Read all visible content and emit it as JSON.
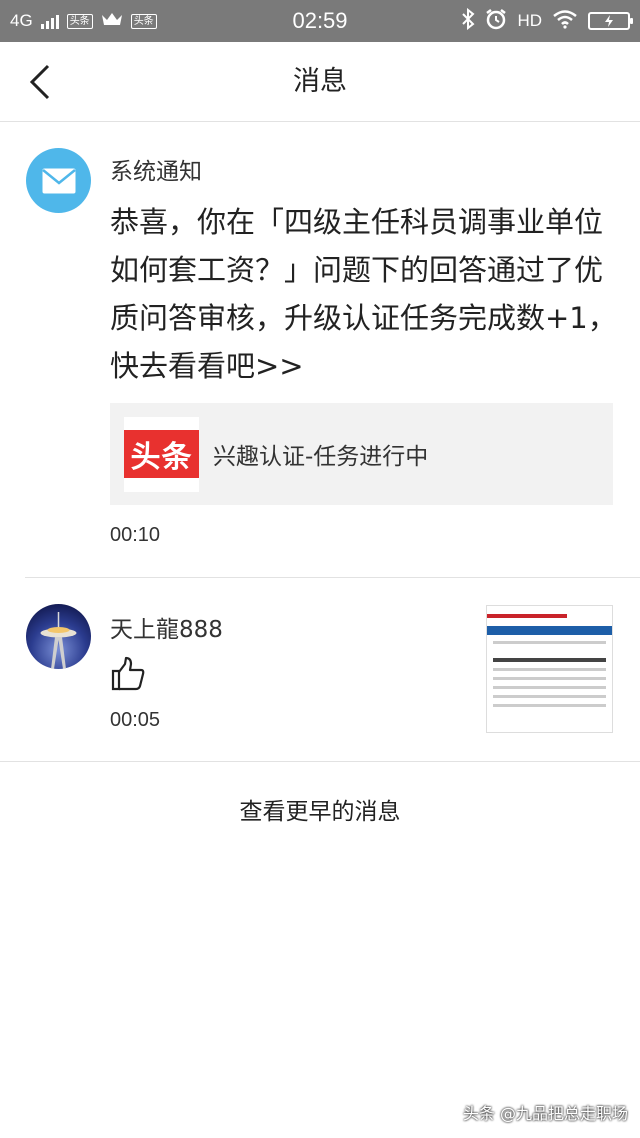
{
  "status_bar": {
    "network": "4G",
    "badge1": "头条",
    "badge2": "头条",
    "time": "02:59",
    "hd": "HD"
  },
  "header": {
    "title": "消息"
  },
  "messages": [
    {
      "sender": "系统通知",
      "body": "恭喜，你在「四级主任科员调事业单位如何套工资？」问题下的回答通过了优质问答审核，升级认证任务完成数+1，快去看看吧>>",
      "card": {
        "logo_text": "头条",
        "text": "兴趣认证-任务进行中"
      },
      "time": "00:10"
    },
    {
      "sender": "天上龍888",
      "time": "00:05"
    }
  ],
  "footer": {
    "earlier_label": "查看更早的消息"
  },
  "watermark": "头条 @九品把总走职场",
  "colors": {
    "status_bar_bg": "#7a7a7a",
    "mail_avatar": "#4fb7ea",
    "toutiao_red": "#e8312f",
    "card_bg": "#f2f2f2"
  }
}
